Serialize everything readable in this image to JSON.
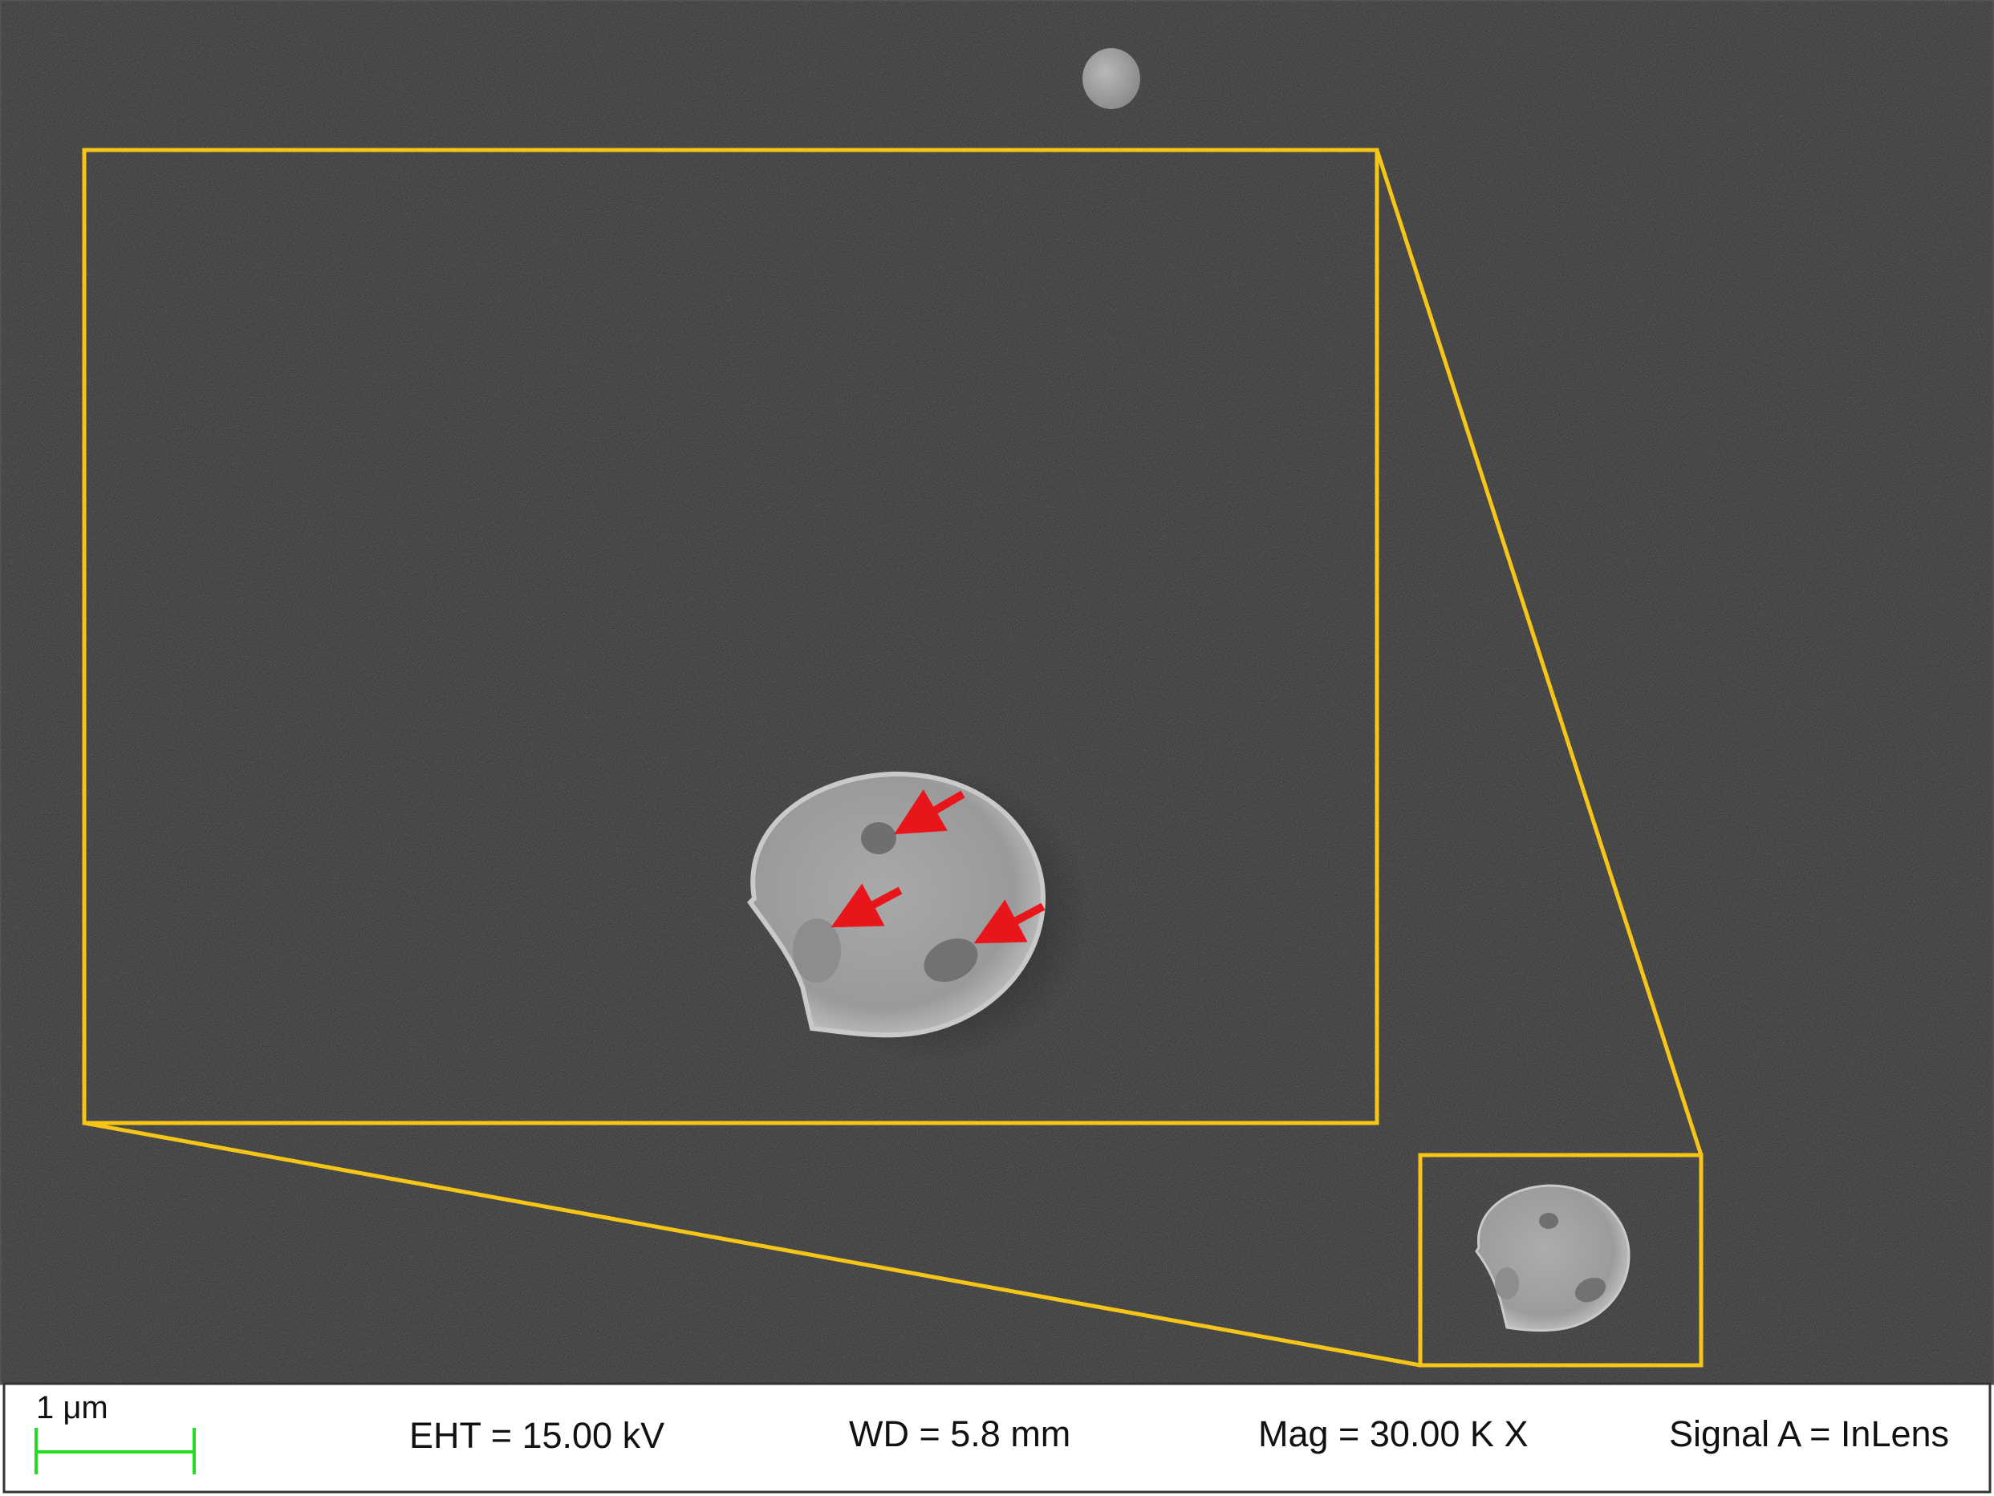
{
  "colors": {
    "background": "#2b2b2b",
    "highlight_box": "#f5c518",
    "arrow": "#e8161b",
    "scale_bar": "#22dd22",
    "info_bar": "#ffffff"
  },
  "info_bar": {
    "scale_label": "1 μm",
    "eht": "EHT = 15.00 kV",
    "wd": "WD =  5.8 mm",
    "mag": "Mag =  30.00 K X",
    "signal": "Signal A = InLens"
  }
}
